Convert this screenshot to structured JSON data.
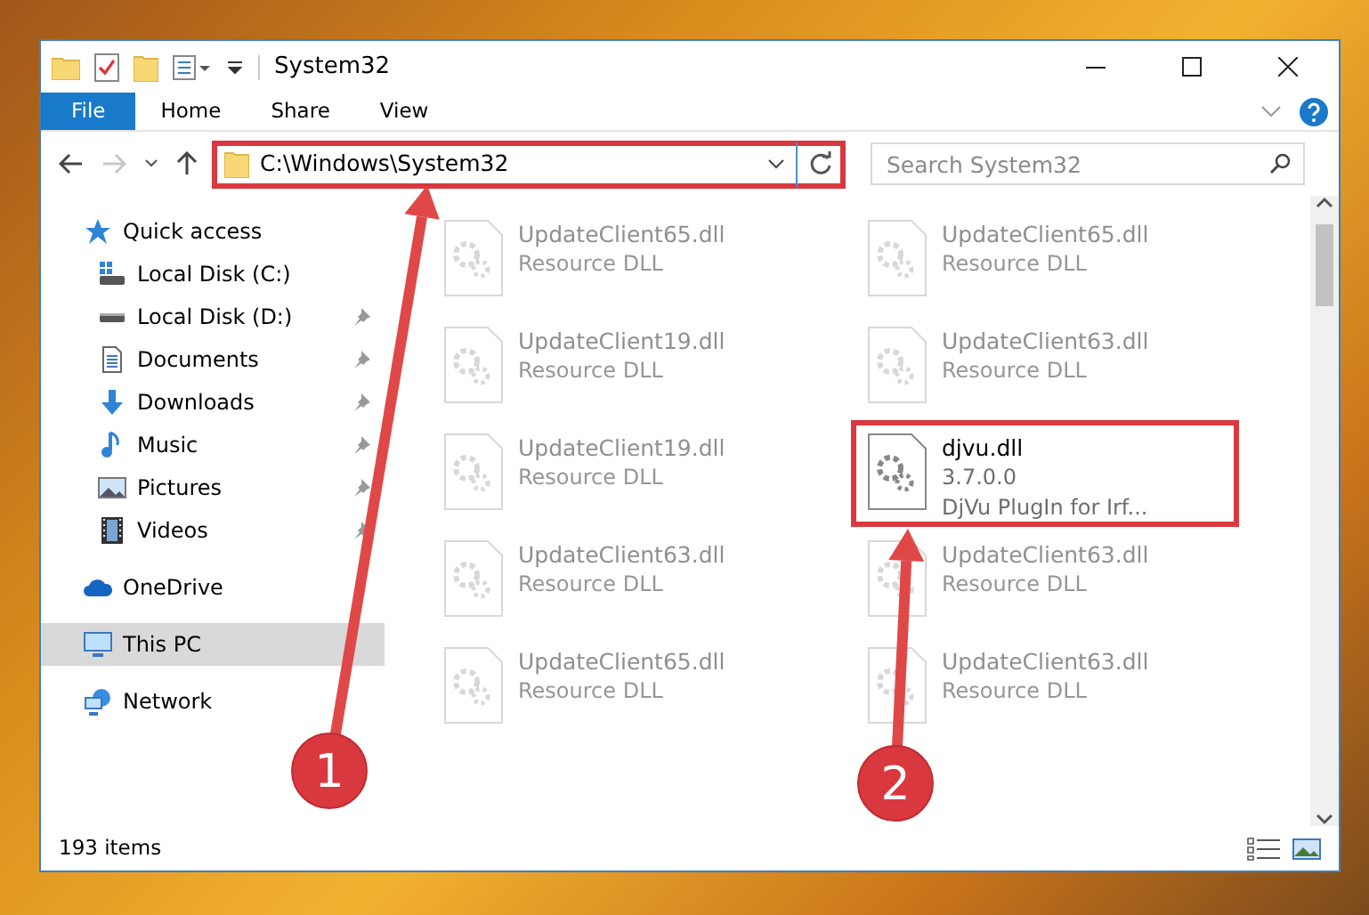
{
  "window": {
    "title": "System32"
  },
  "ribbon": {
    "tabs": [
      {
        "label": "File",
        "kind": "file"
      },
      {
        "label": "Home",
        "kind": "tab"
      },
      {
        "label": "Share",
        "kind": "tab"
      },
      {
        "label": "View",
        "kind": "tab"
      }
    ]
  },
  "address": {
    "path": "C:\\Windows\\System32",
    "highlighted": true
  },
  "search": {
    "placeholder": "Search System32"
  },
  "sidebar": {
    "items": [
      {
        "label": "Quick access",
        "kind": "star",
        "selected": false,
        "children": [
          {
            "label": "Local Disk (C:)",
            "kind": "windows-drive",
            "pinned": false,
            "selected": false
          },
          {
            "label": "Local Disk (D:)",
            "kind": "drive",
            "pinned": true,
            "selected": false
          },
          {
            "label": "Documents",
            "kind": "documents",
            "pinned": true,
            "selected": false
          },
          {
            "label": "Downloads",
            "kind": "downloads",
            "pinned": true,
            "selected": false
          },
          {
            "label": "Music",
            "kind": "music",
            "pinned": true,
            "selected": false
          },
          {
            "label": "Pictures",
            "kind": "pictures",
            "pinned": true,
            "selected": false
          },
          {
            "label": "Videos",
            "kind": "videos",
            "pinned": true,
            "selected": false
          }
        ]
      },
      {
        "label": "OneDrive",
        "kind": "cloud",
        "selected": false
      },
      {
        "label": "This PC",
        "kind": "computer",
        "selected": true
      },
      {
        "label": "Network",
        "kind": "network",
        "selected": false
      }
    ]
  },
  "files": [
    {
      "name": "UpdateClient65.dll",
      "lines": [
        "Resource DLL"
      ],
      "highlighted": false,
      "faded": true
    },
    {
      "name": "UpdateClient65.dll",
      "lines": [
        "Resource DLL"
      ],
      "highlighted": false,
      "faded": true
    },
    {
      "name": "UpdateClient19.dll",
      "lines": [
        "Resource DLL"
      ],
      "highlighted": false,
      "faded": true
    },
    {
      "name": "UpdateClient63.dll",
      "lines": [
        "Resource DLL"
      ],
      "highlighted": false,
      "faded": true
    },
    {
      "name": "UpdateClient19.dll",
      "lines": [
        "Resource DLL"
      ],
      "highlighted": false,
      "faded": true
    },
    {
      "name": "djvu.dll",
      "lines": [
        "3.7.0.0",
        "DjVu PlugIn for Irf..."
      ],
      "highlighted": true,
      "faded": false
    },
    {
      "name": "UpdateClient63.dll",
      "lines": [
        "Resource DLL"
      ],
      "highlighted": false,
      "faded": true
    },
    {
      "name": "UpdateClient63.dll",
      "lines": [
        "Resource DLL"
      ],
      "highlighted": false,
      "faded": true
    },
    {
      "name": "UpdateClient65.dll",
      "lines": [
        "Resource DLL"
      ],
      "highlighted": false,
      "faded": true
    },
    {
      "name": "UpdateClient63.dll",
      "lines": [
        "Resource DLL"
      ],
      "highlighted": false,
      "faded": true
    }
  ],
  "status_bar": {
    "count": "193 items"
  },
  "annotations": [
    {
      "label": "1"
    },
    {
      "label": "2"
    }
  ]
}
